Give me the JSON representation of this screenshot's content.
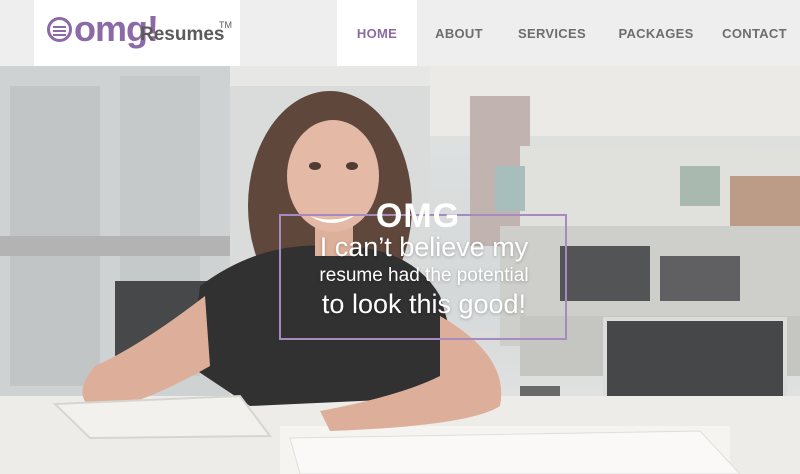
{
  "brand": {
    "logo_icon": "speech-bubble-lines-icon",
    "omg": "omg!",
    "resumes": "Resumes",
    "tm": "TM",
    "accent_color": "#8b6aa7"
  },
  "nav": {
    "home": "HOME",
    "about": "ABOUT",
    "services": "SERVICES",
    "packages": "PACKAGES",
    "contact": "CONTACT",
    "active": "HOME"
  },
  "hero": {
    "omg": "OMG",
    "line1": "I can’t believe my",
    "line2": "resume had the potential",
    "line3": "to look this good!"
  }
}
